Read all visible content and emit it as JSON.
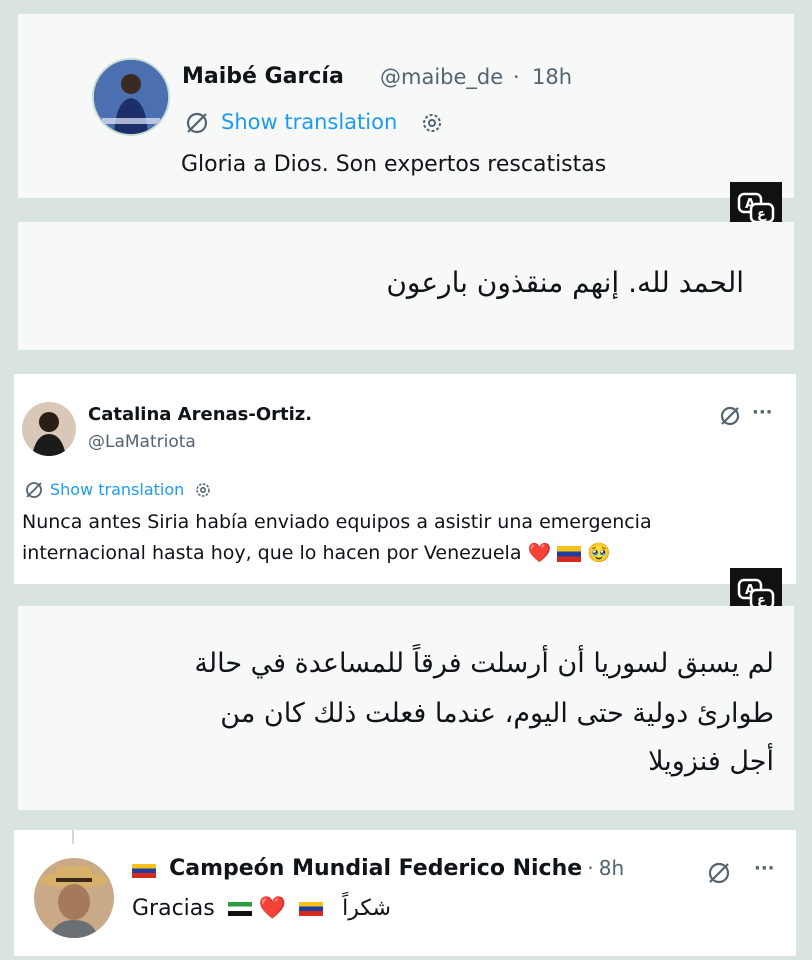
{
  "tweet1": {
    "name": "Maibé García",
    "handle": "@maibe_de",
    "dot": "·",
    "time": "18h",
    "show_translation": "Show translation",
    "text": "Gloria a Dios. Son expertos rescatistas"
  },
  "translation1": {
    "text": "الحمد لله. إنهم منقذون بارعون"
  },
  "tweet2": {
    "name": "Catalina Arenas-Ortiz.",
    "handle": "@LaMatriota",
    "more": "···",
    "show_translation": "Show translation",
    "line1": "Nunca antes Siria había enviado equipos a asistir una emergencia",
    "line2": "internacional hasta hoy, que lo hacen por Venezuela",
    "emojis": "❤️",
    "emoji_smile": "🥹"
  },
  "translation2": {
    "line1": "لم يسبق لسوريا أن أرسلت فرقاً للمساعدة في حالة",
    "line2": "طوارئ دولية حتى اليوم، عندما فعلت ذلك كان من",
    "line3": "أجل فنزويلا"
  },
  "tweet3": {
    "name": "Campeón Mundial Federico Niche",
    "dot": "·",
    "time": "8h",
    "more": "···",
    "text": "Gracias",
    "heart": "❤️",
    "arabic": "شكراً"
  },
  "colors": {
    "background": "#d9e3e0",
    "card": "#f7f9f9",
    "link": "#1d9bf0",
    "muted": "#536471",
    "translate_box": "#111111"
  }
}
